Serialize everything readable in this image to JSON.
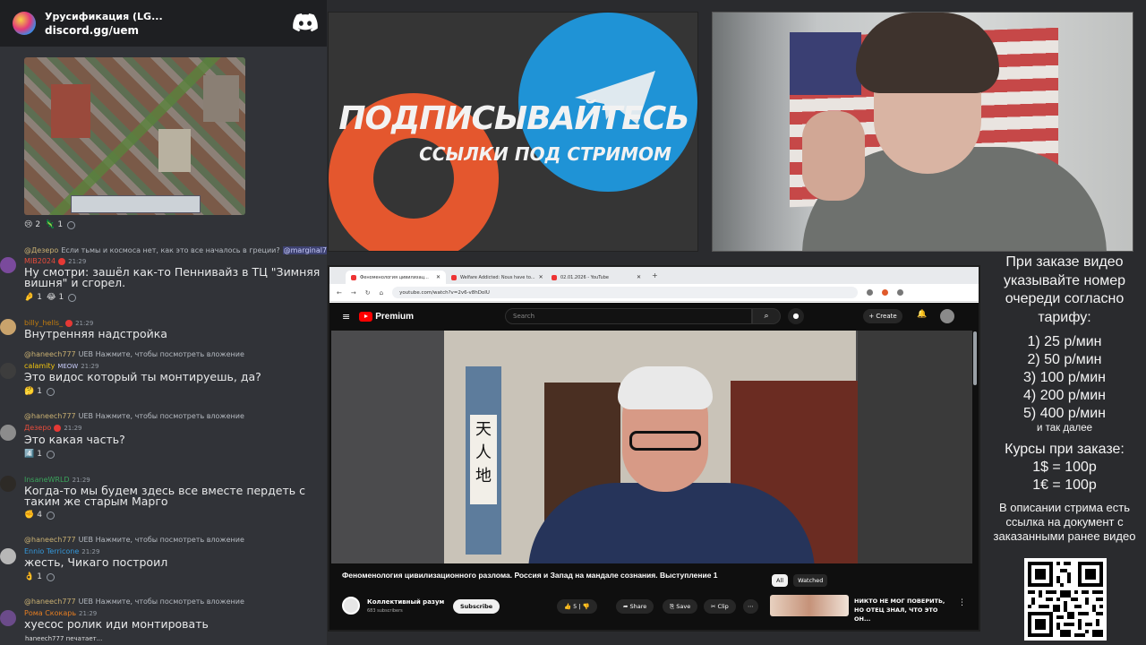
{
  "chat": {
    "server_name": "Урусификация (LG...",
    "invite": "discord.gg/uem",
    "image_reactions": [
      {
        "emoji": "😢",
        "count": "2"
      },
      {
        "emoji": "🦎",
        "count": "1"
      }
    ],
    "messages": [
      {
        "reply_to": "@Дезеро",
        "reply_text": "Если тьмы и космоса нет, как это все началось в греции?",
        "reply_mention": "@marginal777",
        "author": "MIB2024",
        "author_color": "#e74c3c",
        "time": "21:29",
        "text": "Ну смотри: зашёл как-то Пеннивайз в ТЦ \"Зимняя вишня\" и сгорел.",
        "reactions": [
          {
            "emoji": "🤌",
            "count": "1"
          },
          {
            "emoji": "😂",
            "count": "1"
          }
        ]
      },
      {
        "author": "billy_hells_",
        "author_color": "#c27c0e",
        "time": "21:29",
        "text": "Внутренняя надстройка"
      },
      {
        "reply_to": "@haneech777",
        "reply_text": "UEB Нажмите, чтобы посмотреть вложение",
        "author": "calamity",
        "author_color": "#f1c40f",
        "author_tag": "MEOW",
        "time": "21:29",
        "text": "Это видос который ты монтируешь, да?",
        "reactions": [
          {
            "emoji": "🤔",
            "count": "1"
          }
        ]
      },
      {
        "reply_to": "@haneech777",
        "reply_text": "UEB Нажмите, чтобы посмотреть вложение",
        "author": "Дезеро",
        "author_color": "#e74c3c",
        "time": "21:29",
        "text": "Это какая часть?",
        "reactions": [
          {
            "emoji": "4️⃣",
            "count": "1"
          }
        ]
      },
      {
        "author": "InsaneWRLD",
        "author_color": "#3ba55c",
        "time": "21:29",
        "text": "Когда-то мы будем здесь все вместе пердеть с таким же старым Марго",
        "reactions": [
          {
            "emoji": "✊",
            "count": "4"
          }
        ]
      },
      {
        "reply_to": "@haneech777",
        "reply_text": "UEB Нажмите, чтобы посмотреть вложение",
        "author": "Ennio Terricone",
        "author_color": "#3498db",
        "time": "21:29",
        "text": "жесть, Чикаго построил",
        "reactions": [
          {
            "emoji": "👌",
            "count": "1"
          }
        ]
      },
      {
        "reply_to": "@haneech777",
        "reply_text": "UEB Нажмите, чтобы посмотреть вложение",
        "author": "Рома Скокарь",
        "author_color": "#e67e22",
        "time": "21:29",
        "text": "хуесос ролик иди монтировать"
      }
    ],
    "typing": "haneech777 печатает..."
  },
  "promo": {
    "title": "ПОДПИСЫВАЙТЕСЬ",
    "subtitle": "ССЫЛКИ ПОД СТРИМОМ"
  },
  "browser": {
    "tabs": [
      {
        "label": "Феноменология цивилизац...",
        "active": true
      },
      {
        "label": "Welfare Addicted: Nous have to...",
        "active": false
      },
      {
        "label": "02.01.2026 - YouTube",
        "active": false
      }
    ],
    "url": "youtube.com/watch?v=2v6-v8hDoIU",
    "yt": {
      "logo": "Premium",
      "search_placeholder": "Search",
      "create": "+ Create",
      "video_title": "Феноменология цивилизационного разлома. Россия и Запад на мандале сознания. Выступление 1",
      "calligraphy": "天人地",
      "chips": [
        "All",
        "Watched"
      ],
      "channel": "Коллективный разум",
      "subscribers": "683 subscribers",
      "subscribe": "Subscribe",
      "likes": "5",
      "share": "Share",
      "save": "Save",
      "clip": "Clip",
      "rec_title": "НИКТО НЕ МОГ ПОВЕРИТЬ, НО ОТЕЦ ЗНАЛ, ЧТО ЭТО ОН..."
    }
  },
  "info": {
    "head": "При заказе видео указывайте номер очереди согласно тарифу:",
    "tariffs": [
      "1) 25 р/мин",
      "2) 50 р/мин",
      "3) 100 р/мин",
      "4) 200 р/мин",
      "5) 400 р/мин"
    ],
    "tariffs_more": "и так далее",
    "courses_title": "Курсы при заказе:",
    "courses": [
      "1$ = 100р",
      "1€ = 100р"
    ],
    "desc": "В описании стрима есть ссылка на документ с заказанными ранее видео"
  }
}
